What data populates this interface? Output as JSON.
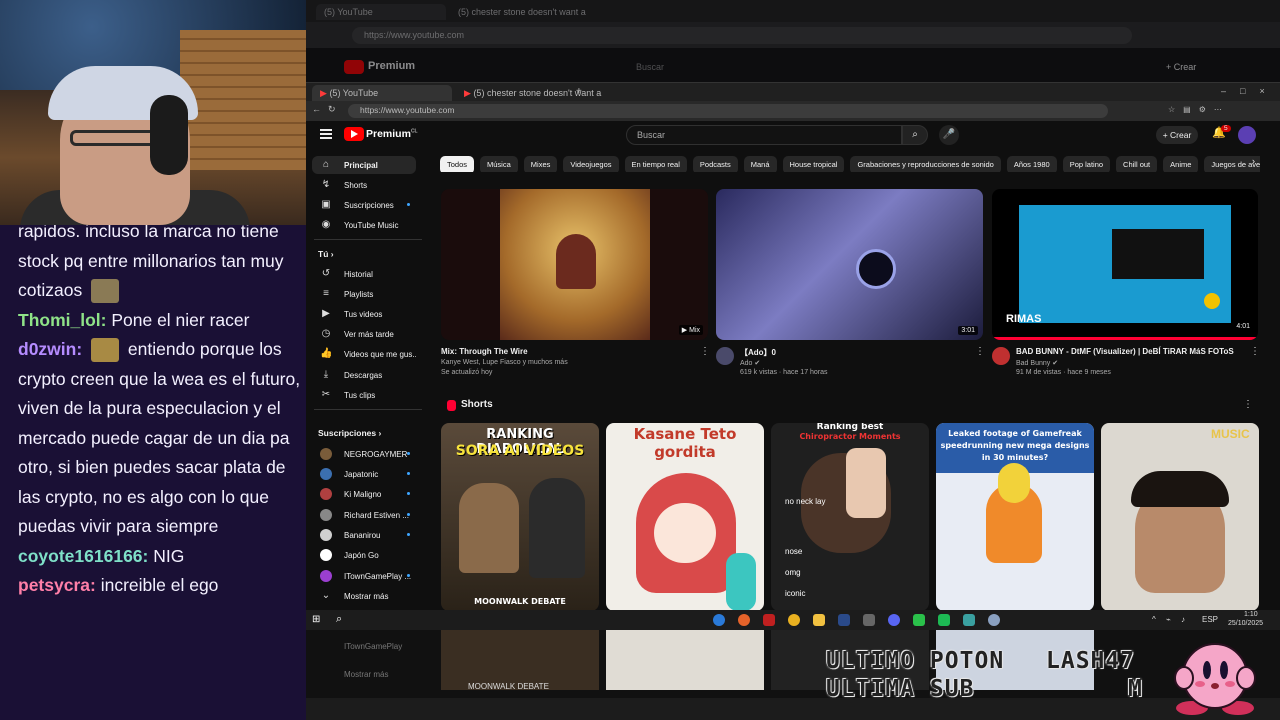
{
  "chat": {
    "lines": [
      {
        "user": "",
        "text": "rapidos. incluso la marca no tiene stock pq entre millonarios tan muy cotizaos",
        "color": "#f3f0ff"
      },
      {
        "user": "Thomi_lol:",
        "text": "Pone el nier racer",
        "color": "#8fe388"
      },
      {
        "user": "d0zwin:",
        "text": "entiendo porque los crypto creen que la wea es el futuro, viven de la pura especulacion y el mercado puede cagar de un dia pa otro, si bien puedes sacar plata de las crypto, no es algo con lo que puedas vivir para siempre",
        "color": "#b58cff"
      },
      {
        "user": "coyote1616166:",
        "text": "NIG",
        "color": "#7fe0c8"
      },
      {
        "user": "petsycra:",
        "text": "increible el ego",
        "color": "#ff7fa8"
      }
    ]
  },
  "outer_browser": {
    "tab1": "(5) YouTube",
    "tab2": "(5) chester stone doesn't want a",
    "url": "https://www.youtube.com",
    "search_placeholder": "Buscar",
    "create": "+ Crear",
    "brand": "Premium"
  },
  "browser": {
    "tab1": "(5) YouTube",
    "tab2": "(5) chester stone doesn't want a",
    "url": "https://www.youtube.com"
  },
  "youtube": {
    "brand": "Premium",
    "brand_sup": "CL",
    "search_placeholder": "Buscar",
    "create_label": "Crear",
    "notif_count": "5",
    "sidebar": {
      "main": [
        {
          "label": "Principal",
          "icon": "⌂"
        },
        {
          "label": "Shorts",
          "icon": "↯"
        },
        {
          "label": "Suscripciones",
          "icon": "▣"
        },
        {
          "label": "YouTube Music",
          "icon": "◉"
        }
      ],
      "you_header": "Tú",
      "you": [
        {
          "label": "Historial",
          "icon": "↺"
        },
        {
          "label": "Playlists",
          "icon": "≡"
        },
        {
          "label": "Tus videos",
          "icon": "▶"
        },
        {
          "label": "Ver más tarde",
          "icon": "◷"
        },
        {
          "label": "Videos que me gus...",
          "icon": "👍"
        },
        {
          "label": "Descargas",
          "icon": "⤓"
        },
        {
          "label": "Tus clips",
          "icon": "✂"
        }
      ],
      "subs_header": "Suscripciones",
      "subs": [
        {
          "label": "NEGROGAYMER",
          "color": "#7a5c3a"
        },
        {
          "label": "Japatonic",
          "color": "#3b6fb0"
        },
        {
          "label": "Ki Maligno",
          "color": "#b04040"
        },
        {
          "label": "Richard Estiven ...",
          "color": "#888888"
        },
        {
          "label": "Bananirou",
          "color": "#d0d0d0"
        },
        {
          "label": "Japón Go",
          "color": "#ffffff"
        },
        {
          "label": "ITownGamePlay ...",
          "color": "#9b3fd0"
        }
      ],
      "show_more": "Mostrar más"
    },
    "chips": [
      "Todos",
      "Música",
      "Mixes",
      "Videojuegos",
      "En tiempo real",
      "Podcasts",
      "Maná",
      "House tropical",
      "Grabaciones y reproducciones de sonido",
      "Años 1980",
      "Pop latino",
      "Chill out",
      "Anime",
      "Juegos de aventura y"
    ],
    "videos": [
      {
        "title": "Mix: Through The Wire",
        "line1": "Kanye West, Lupe Fiasco y muchos más",
        "line2": "Se actualizó hoy",
        "badge": "Mix"
      },
      {
        "title": "【Ado】0",
        "line1": "Ado ✔",
        "line2": "619 k vistas · hace 17 horas",
        "duration": "3:01"
      },
      {
        "title": "BAD BUNNY - DtMF (Visualizer) | DeBÍ TiRAR MáS FOToS",
        "line1": "Bad Bunny ✔",
        "line2": "91 M de vistas · hace 9 meses",
        "duration": "4:01",
        "overlay": "RIMAS"
      }
    ],
    "shorts_title": "Shorts",
    "shorts": [
      {
        "top": "RANKING DIABOLICAL",
        "mid": "SORA AI VIDEOS",
        "bottom": "MOONWALK DEBATE"
      },
      {
        "top": "Kasane Teto",
        "mid": "gordita"
      },
      {
        "top": "Ranking best",
        "mid": "Chiropractor Moments",
        "labels": [
          "no neck lay",
          "nose",
          "omg",
          "iconic"
        ]
      },
      {
        "top": "Leaked footage of Gamefreak",
        "mid": "speedrunning new mega designs",
        "bottom": "in 30 minutes?"
      },
      {
        "top": "MUSIC"
      }
    ]
  },
  "taskbar": {
    "lang": "ESP",
    "time": "1:10",
    "date": "25/10/2025"
  },
  "mirror": {
    "sidebar1": "ITownGamePlay",
    "sidebar2": "Mostrar más",
    "short_text": "MOONWALK DEBATE"
  },
  "overlay": {
    "line1": "ULTIMO POTON",
    "line2": "ULTIMA SUB",
    "line3": "LASH47",
    "line4": "M"
  }
}
